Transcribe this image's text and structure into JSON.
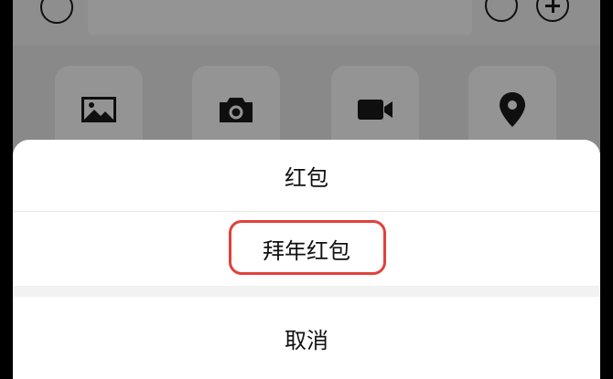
{
  "action_sheet": {
    "items": [
      {
        "label": "红包"
      },
      {
        "label": "拜年红包"
      }
    ],
    "cancel_label": "取消"
  },
  "tools": [
    {
      "icon": "image-icon"
    },
    {
      "icon": "camera-icon"
    },
    {
      "icon": "video-icon"
    },
    {
      "icon": "location-icon"
    }
  ],
  "colors": {
    "highlight": "#e0413a",
    "overlay": "rgba(0,0,0,0.42)"
  }
}
